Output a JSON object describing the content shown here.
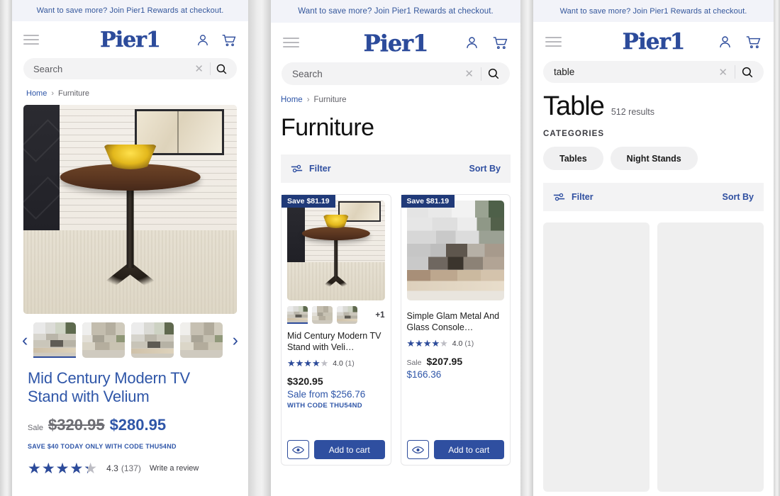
{
  "promo": {
    "text": "Want to save more? Join Pier1 Rewards at checkout."
  },
  "brand": {
    "logo": "Pier1",
    "accent": "#2c4b9b",
    "button": "#2f4fa0",
    "badge": "#203a79"
  },
  "icons": {
    "menu": "hamburger-menu-icon",
    "account": "user-account-icon",
    "cart": "shopping-cart-icon",
    "search": "magnifier-icon",
    "clear": "clear-x-icon",
    "filter": "filter-sliders-icon",
    "eye": "quick-view-eye-icon",
    "prev": "chevron-left-icon",
    "next": "chevron-right-icon"
  },
  "panel1": {
    "search": {
      "placeholder": "Search",
      "value": ""
    },
    "breadcrumb": {
      "home": "Home",
      "separator": "›",
      "current": "Furniture"
    },
    "gallery": {
      "prev_label": "‹",
      "next_label": "›",
      "thumb_count": 4,
      "active_index": 0
    },
    "product": {
      "title": "Mid Century Modern TV Stand with Velium",
      "sale_label": "Sale",
      "original_price": "$320.95",
      "sale_price": "$280.95",
      "promo_text": "SAVE $40 TODAY ONLY WITH CODE THU54ND",
      "rating_value": "4.3",
      "rating_percent": 86,
      "review_count": "(137)",
      "write_review": "Write a review"
    }
  },
  "panel2": {
    "search": {
      "placeholder": "Search",
      "value": ""
    },
    "breadcrumb": {
      "home": "Home",
      "separator": "›",
      "current": "Furniture"
    },
    "page_title": "Furniture",
    "toolbar": {
      "filter": "Filter",
      "sort_by": "Sort By"
    },
    "products": [
      {
        "badge": "Save $81.19",
        "title": "Mid Century Modern TV Stand with Veli…",
        "rating_value": "4.0",
        "rating_percent": 80,
        "review_count": "(1)",
        "price_style": "from",
        "original_price": "$320.95",
        "sale_price": "Sale from $256.76",
        "code_text": "WITH CODE THU54ND",
        "thumb_count": 3,
        "more_label": "+1",
        "quick_view": "Quick view",
        "add_to_cart": "Add to cart"
      },
      {
        "badge": "Save $81.19",
        "title": "Simple Glam Metal And Glass Console…",
        "rating_value": "4.0",
        "rating_percent": 80,
        "review_count": "(1)",
        "price_style": "sale",
        "sale_label": "Sale",
        "original_price": "$207.95",
        "sale_price": "$166.36",
        "quick_view": "Quick view",
        "add_to_cart": "Add to cart"
      }
    ]
  },
  "panel3": {
    "search": {
      "placeholder": "Search",
      "value": "table"
    },
    "results": {
      "query": "Table",
      "count_text": "512 results"
    },
    "categories_label": "CATEGORIES",
    "categories": [
      {
        "label": "Tables"
      },
      {
        "label": "Night Stands"
      }
    ],
    "toolbar": {
      "filter": "Filter",
      "sort_by": "Sort By"
    },
    "skeleton_count": 2
  }
}
